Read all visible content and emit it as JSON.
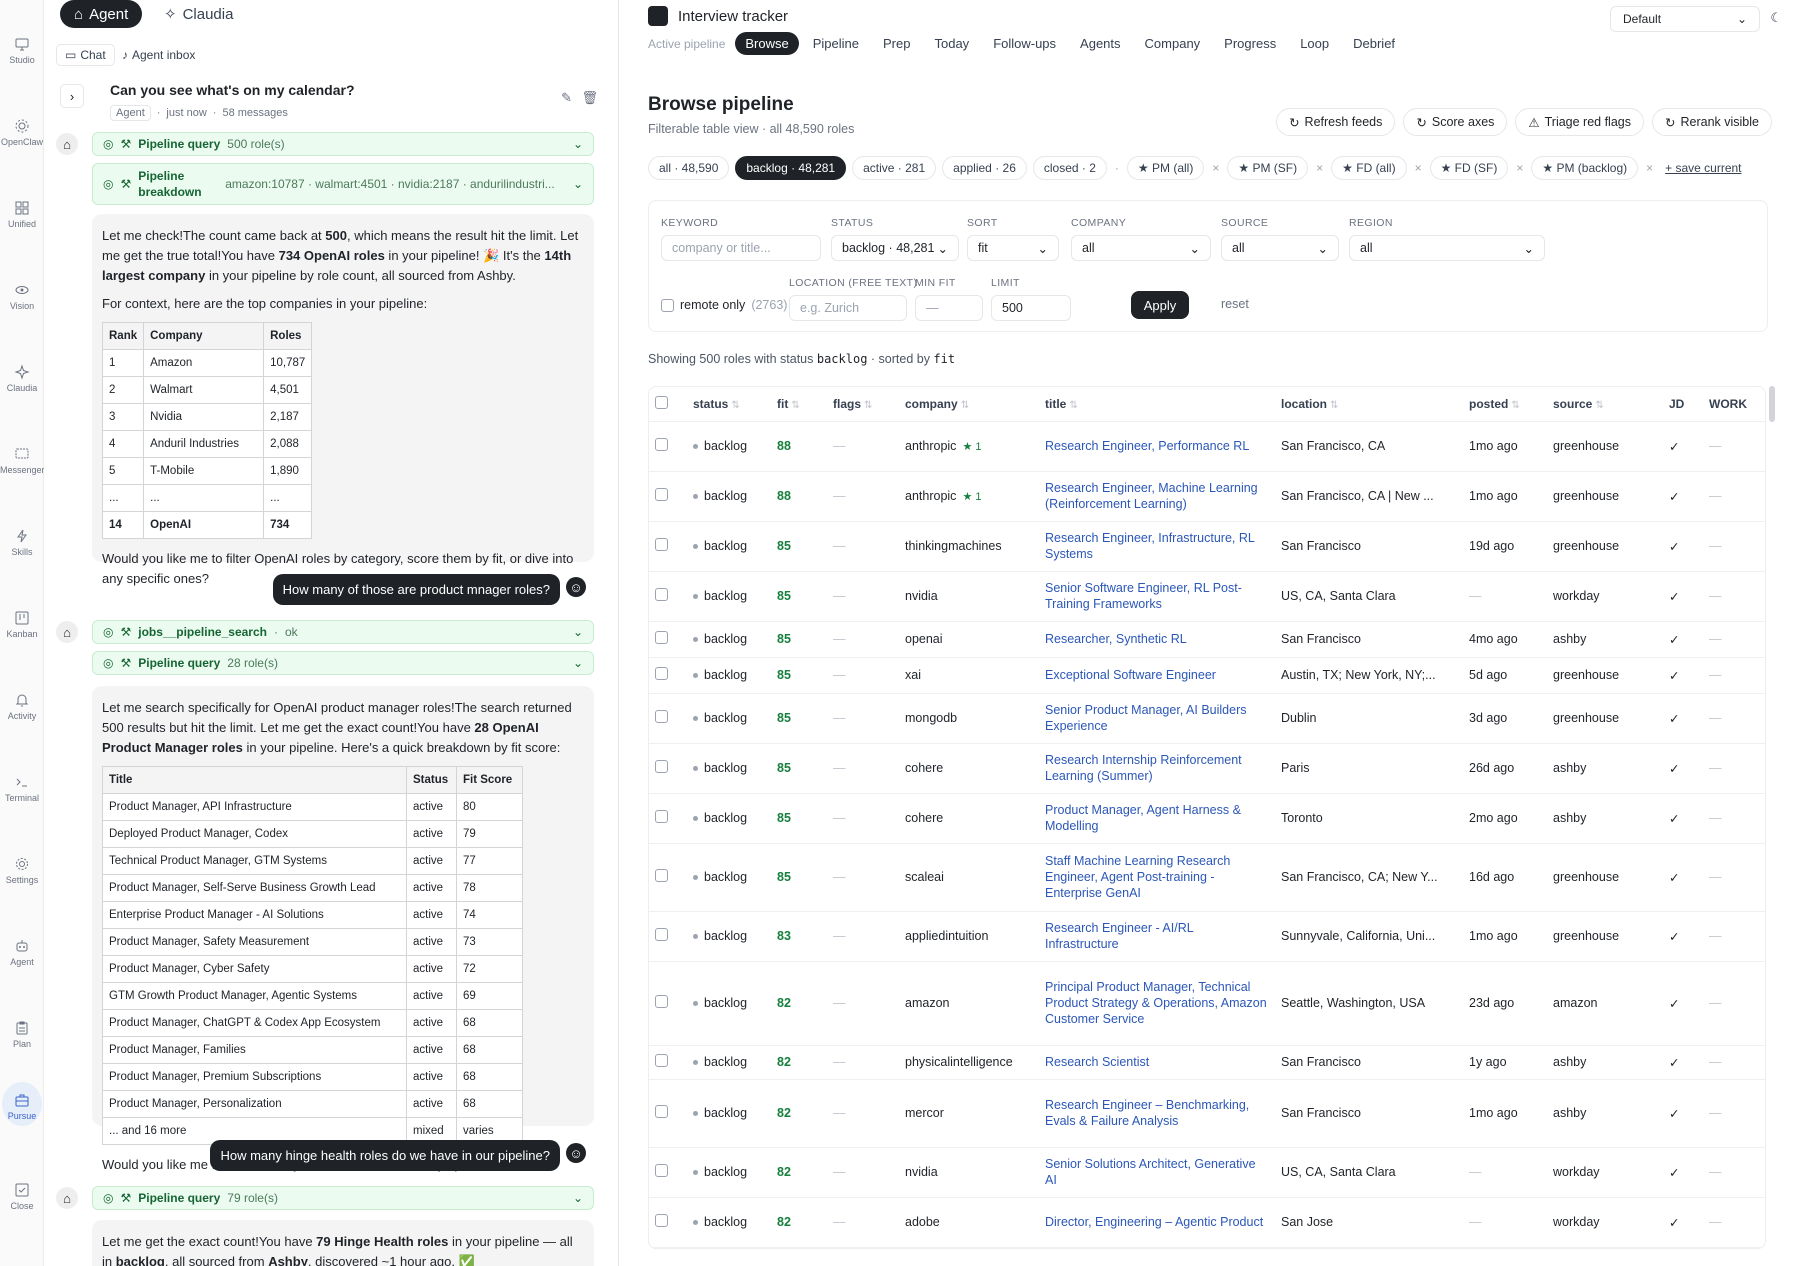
{
  "rail": [
    {
      "label": "Studio",
      "icon": "monitor-icon"
    },
    {
      "label": "OpenClaw",
      "icon": "gear-icon"
    },
    {
      "label": "Unified",
      "icon": "grid-icon"
    },
    {
      "label": "Vision",
      "icon": "eye-icon"
    },
    {
      "label": "Claudia",
      "icon": "sparkle-icon"
    },
    {
      "label": "Messenger",
      "icon": "message-icon"
    },
    {
      "label": "Skills",
      "icon": "bolt-icon"
    },
    {
      "label": "Kanban",
      "icon": "kanban-icon"
    },
    {
      "label": "Activity",
      "icon": "bell-icon"
    },
    {
      "label": "Terminal",
      "icon": "terminal-icon"
    },
    {
      "label": "Settings",
      "icon": "settings-icon"
    },
    {
      "label": "Agent",
      "icon": "robot-icon"
    },
    {
      "label": "Plan",
      "icon": "clipboard-icon"
    },
    {
      "label": "Pursue",
      "icon": "briefcase-icon"
    },
    {
      "label": "Close",
      "icon": "check-square-icon"
    }
  ],
  "chat": {
    "modes": {
      "agent": "Agent",
      "claudia": "Claudia"
    },
    "subtabs": {
      "chat": "Chat",
      "inbox": "Agent inbox"
    },
    "convo": {
      "title": "Can you see what's on my calendar?",
      "agent_chip": "Agent",
      "time": "just now",
      "count": "58 messages"
    },
    "tool1": {
      "name": "Pipeline query",
      "meta": "500 role(s)"
    },
    "tool2": {
      "name1": "Pipeline",
      "name2": "breakdown",
      "meta": "amazon:10787 · walmart:4501 · nvidia:2187 · andurilindustri..."
    },
    "msg1": {
      "p1a": "Let me check!The count came back at ",
      "p1b": "500",
      "p1c": ", which means the result hit the limit. Let me get the true total!You have ",
      "p1d": "734 OpenAI roles",
      "p1e": " in your pipeline! 🎉 It's the ",
      "p1f": "14th largest company",
      "p1g": " in your pipeline by role count, all sourced from Ashby.",
      "p2": "For context, here are the top companies in your pipeline:",
      "headers": [
        "Rank",
        "Company",
        "Roles"
      ],
      "rows": [
        [
          "1",
          "Amazon",
          "10,787"
        ],
        [
          "2",
          "Walmart",
          "4,501"
        ],
        [
          "3",
          "Nvidia",
          "2,187"
        ],
        [
          "4",
          "Anduril Industries",
          "2,088"
        ],
        [
          "5",
          "T-Mobile",
          "1,890"
        ],
        [
          "...",
          "...",
          "..."
        ]
      ],
      "last": [
        "14",
        "OpenAI",
        "734"
      ],
      "p3": "Would you like me to filter OpenAI roles by category, score them by fit, or dive into any specific ones?"
    },
    "user1": "How many of those are product mnager roles?",
    "tool3": {
      "name": "jobs__pipeline_search",
      "meta": "ok"
    },
    "tool4": {
      "name": "Pipeline query",
      "meta": "28 role(s)"
    },
    "msg2": {
      "p1a": "Let me search specifically for OpenAI product manager roles!The search returned 500 results but hit the limit. Let me get the exact count!You have ",
      "p1b": "28 OpenAI Product Manager roles",
      "p1c": " in your pipeline. Here's a quick breakdown by fit score:",
      "headers": [
        "Title",
        "Status",
        "Fit Score"
      ],
      "rows": [
        [
          "Product Manager, API Infrastructure",
          "active",
          "80"
        ],
        [
          "Deployed Product Manager, Codex",
          "active",
          "79"
        ],
        [
          "Technical Product Manager, GTM Systems",
          "active",
          "77"
        ],
        [
          "Product Manager, Self-Serve Business Growth Lead",
          "active",
          "78"
        ],
        [
          "Enterprise Product Manager - AI Solutions",
          "active",
          "74"
        ],
        [
          "Product Manager, Safety Measurement",
          "active",
          "73"
        ],
        [
          "Product Manager, Cyber Safety",
          "active",
          "72"
        ],
        [
          "GTM Growth Product Manager, Agentic Systems",
          "active",
          "69"
        ],
        [
          "Product Manager, ChatGPT & Codex App Ecosystem",
          "active",
          "68"
        ],
        [
          "Product Manager, Families",
          "active",
          "68"
        ],
        [
          "Product Manager, Premium Subscriptions",
          "active",
          "68"
        ],
        [
          "Product Manager, Personalization",
          "active",
          "68"
        ],
        [
          "... and 16 more",
          "mixed",
          "varies"
        ]
      ],
      "p2": "Would you like me to sort all 28 by fit score, or dive into any specific role?"
    },
    "user2": "How many hinge health roles do we have in our pipeline?",
    "tool5": {
      "name": "Pipeline query",
      "meta": "79 role(s)"
    },
    "msg3": {
      "a": "Let me get the exact count!You have ",
      "b": "79 Hinge Health roles",
      "c": " in your pipeline — all in ",
      "d": "backlog",
      "e": ", all sourced from ",
      "f": "Ashby",
      "g": ", discovered ~1 hour ago. ✅"
    }
  },
  "main": {
    "app_title": "Interview tracker",
    "nav_label": "Active pipeline",
    "nav": [
      "Browse",
      "Pipeline",
      "Prep",
      "Today",
      "Follow-ups",
      "Agents",
      "Company",
      "Progress",
      "Loop",
      "Debrief"
    ],
    "theme_select": "Default",
    "heading": "Browse pipeline",
    "subheading": "Filterable table view · all 48,590 roles",
    "actions": [
      "Refresh feeds",
      "Score axes",
      "Triage red flags",
      "Rerank visible"
    ],
    "chips": [
      "all · 48,590",
      "backlog · 48,281",
      "active · 281",
      "applied · 26",
      "closed · 2"
    ],
    "saved": [
      "PM (all)",
      "PM (SF)",
      "FD (all)",
      "FD (SF)",
      "PM (backlog)"
    ],
    "save_current": "+ save current",
    "filters": {
      "keyword_label": "KEYWORD",
      "keyword_ph": "company or title...",
      "status_label": "STATUS",
      "status_val": "backlog · 48,281",
      "sort_label": "SORT",
      "sort_val": "fit",
      "company_label": "COMPANY",
      "company_val": "all",
      "source_label": "SOURCE",
      "source_val": "all",
      "region_label": "REGION",
      "region_val": "all",
      "remote_label": "remote only",
      "remote_count": "(2763)",
      "location_label": "LOCATION (FREE TEXT)",
      "location_ph": "e.g. Zurich",
      "minfit_label": "MIN FIT",
      "minfit_ph": "—",
      "limit_label": "LIMIT",
      "limit_val": "500",
      "apply": "Apply",
      "reset": "reset"
    },
    "showing": {
      "a": "Showing 500 roles with status ",
      "b": "backlog",
      "c": " · sorted by ",
      "d": "fit"
    },
    "columns": [
      "status",
      "fit",
      "flags",
      "company",
      "title",
      "location",
      "posted",
      "source",
      "JD",
      "WORK"
    ],
    "rows": [
      {
        "status": "backlog",
        "fit": "88",
        "company": "anthropic",
        "star": "★ 1",
        "title": "Research Engineer, Performance RL",
        "location": "San Francisco, CA",
        "posted": "1mo ago",
        "source": "greenhouse",
        "h": 50
      },
      {
        "status": "backlog",
        "fit": "88",
        "company": "anthropic",
        "star": "★ 1",
        "title": "Research Engineer, Machine Learning (Reinforcement Learning)",
        "location": "San Francisco, CA | New ...",
        "posted": "1mo ago",
        "source": "greenhouse",
        "h": 50
      },
      {
        "status": "backlog",
        "fit": "85",
        "company": "thinkingmachines",
        "star": "",
        "title": "Research Engineer, Infrastructure, RL Systems",
        "location": "San Francisco",
        "posted": "19d ago",
        "source": "greenhouse",
        "h": 50
      },
      {
        "status": "backlog",
        "fit": "85",
        "company": "nvidia",
        "star": "",
        "title": "Senior Software Engineer, RL Post-Training Frameworks",
        "location": "US, CA, Santa Clara",
        "posted": "—",
        "source": "workday",
        "h": 50
      },
      {
        "status": "backlog",
        "fit": "85",
        "company": "openai",
        "star": "",
        "title": "Researcher, Synthetic RL",
        "location": "San Francisco",
        "posted": "4mo ago",
        "source": "ashby",
        "h": 36
      },
      {
        "status": "backlog",
        "fit": "85",
        "company": "xai",
        "star": "",
        "title": "Exceptional Software Engineer",
        "location": "Austin, TX; New York, NY;...",
        "posted": "5d ago",
        "source": "greenhouse",
        "h": 36
      },
      {
        "status": "backlog",
        "fit": "85",
        "company": "mongodb",
        "star": "",
        "title": "Senior Product Manager, AI Builders Experience",
        "location": "Dublin",
        "posted": "3d ago",
        "source": "greenhouse",
        "h": 50
      },
      {
        "status": "backlog",
        "fit": "85",
        "company": "cohere",
        "star": "",
        "title": "Research Internship Reinforcement Learning (Summer)",
        "location": "Paris",
        "posted": "26d ago",
        "source": "ashby",
        "h": 50
      },
      {
        "status": "backlog",
        "fit": "85",
        "company": "cohere",
        "star": "",
        "title": "Product Manager, Agent Harness & Modelling",
        "location": "Toronto",
        "posted": "2mo ago",
        "source": "ashby",
        "h": 50
      },
      {
        "status": "backlog",
        "fit": "85",
        "company": "scaleai",
        "star": "",
        "title": "Staff Machine Learning Research Engineer, Agent Post-training - Enterprise GenAI",
        "location": "San Francisco, CA; New Y...",
        "posted": "16d ago",
        "source": "greenhouse",
        "h": 68
      },
      {
        "status": "backlog",
        "fit": "83",
        "company": "appliedintuition",
        "star": "",
        "title": "Research Engineer - AI/RL Infrastructure",
        "location": "Sunnyvale, California, Uni...",
        "posted": "1mo ago",
        "source": "greenhouse",
        "h": 50
      },
      {
        "status": "backlog",
        "fit": "82",
        "company": "amazon",
        "star": "",
        "title": "Principal Product Manager, Technical Product Strategy & Operations, Amazon Customer Service",
        "location": "Seattle, Washington, USA",
        "posted": "23d ago",
        "source": "amazon",
        "h": 84
      },
      {
        "status": "backlog",
        "fit": "82",
        "company": "physicalintelligence",
        "star": "",
        "title": "Research Scientist",
        "location": "San Francisco",
        "posted": "1y ago",
        "source": "ashby",
        "h": 34
      },
      {
        "status": "backlog",
        "fit": "82",
        "company": "mercor",
        "star": "",
        "title": "Research Engineer – Benchmarking, Evals & Failure Analysis",
        "location": "San Francisco",
        "posted": "1mo ago",
        "source": "ashby",
        "h": 68
      },
      {
        "status": "backlog",
        "fit": "82",
        "company": "nvidia",
        "star": "",
        "title": "Senior Solutions Architect, Generative AI",
        "location": "US, CA, Santa Clara",
        "posted": "—",
        "source": "workday",
        "h": 50
      },
      {
        "status": "backlog",
        "fit": "82",
        "company": "adobe",
        "star": "",
        "title": "Director, Engineering – Agentic Product",
        "location": "San Jose",
        "posted": "—",
        "source": "workday",
        "h": 50
      }
    ],
    "jd_mark": "✓",
    "dash": "—"
  }
}
